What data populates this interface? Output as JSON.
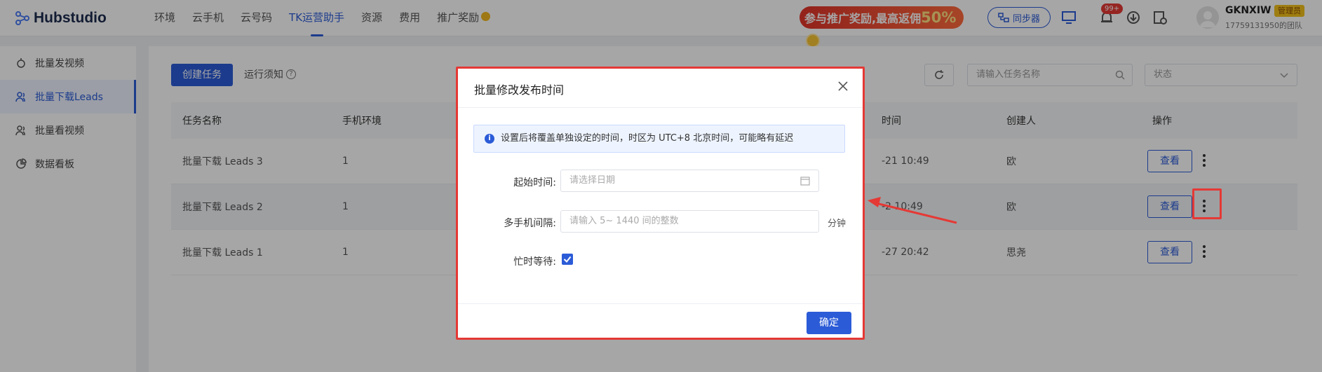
{
  "header": {
    "logo_text": "Hubstudio",
    "nav": [
      "环境",
      "云手机",
      "云号码",
      "TK运营助手",
      "资源",
      "费用",
      "推广奖励"
    ],
    "promo_text": "参与推广奖励,最高返佣",
    "promo_highlight": "50%",
    "sync_label": "同步器",
    "notification_badge": "99+",
    "user_name": "GKNXIW",
    "admin_tag": "管理员",
    "team": "17759131950的团队"
  },
  "sidebar": {
    "items": [
      "批量发视频",
      "批量下载Leads",
      "批量看视频",
      "数据看板"
    ]
  },
  "toolbar": {
    "create_label": "创建任务",
    "notice_label": "运行须知",
    "search_placeholder": "请输入任务名称",
    "status_placeholder": "状态"
  },
  "table": {
    "headers": [
      "任务名称",
      "手机环境",
      "时间",
      "创建人",
      "操作"
    ],
    "rows": [
      {
        "name": "批量下载 Leads 3",
        "phones": "1",
        "time": "-21 10:49",
        "creator": "欧"
      },
      {
        "name": "批量下载 Leads 2",
        "phones": "1",
        "time": "-2 10:49",
        "creator": "欧"
      },
      {
        "name": "批量下载 Leads 1",
        "phones": "1",
        "time": "-27 20:42",
        "creator": "思尧"
      }
    ],
    "view_label": "查看"
  },
  "modal": {
    "title": "批量修改发布时间",
    "alert": "设置后将覆盖单独设定的时间，时区为 UTC+8 北京时间，可能略有延迟",
    "start_label": "起始时间:",
    "start_placeholder": "请选择日期",
    "interval_label": "多手机间隔:",
    "interval_placeholder": "请输入 5~ 1440 间的整数",
    "interval_unit": "分钟",
    "wait_label": "忙时等待:",
    "wait_checked": true,
    "confirm_label": "确定"
  },
  "colors": {
    "primary": "#2b5bd7",
    "annotation_red": "#e53935"
  }
}
